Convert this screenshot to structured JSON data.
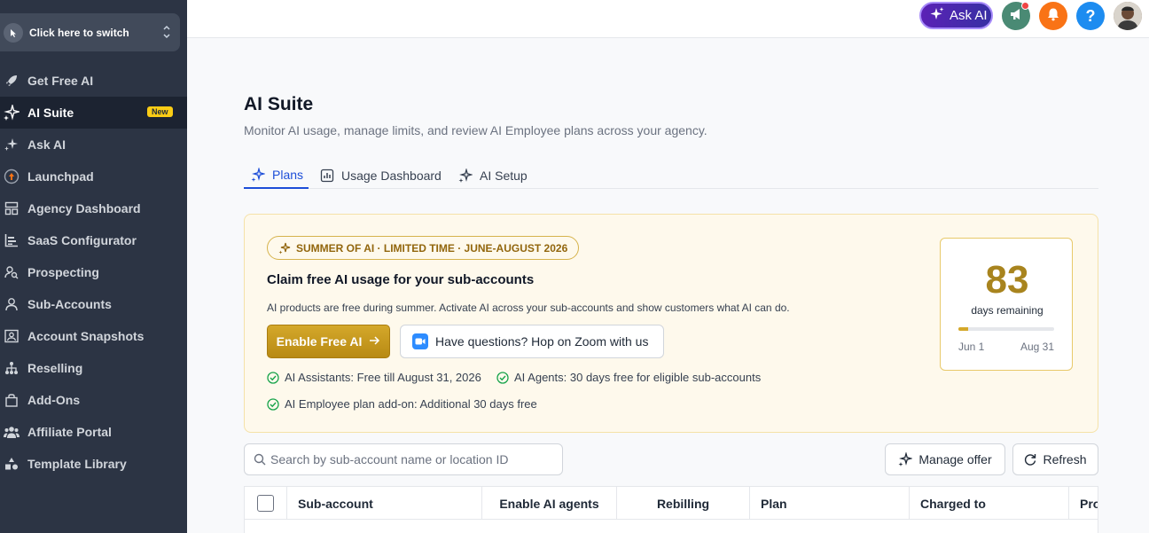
{
  "switcher": {
    "label": "Click here to switch"
  },
  "sidebar": {
    "items": [
      {
        "label": "Get Free AI",
        "icon": "rocket-icon"
      },
      {
        "label": "AI Suite",
        "icon": "sparkles-icon",
        "badge": "New"
      },
      {
        "label": "Ask AI",
        "icon": "sparkles-icon"
      },
      {
        "label": "Launchpad",
        "icon": "launchpad-icon"
      },
      {
        "label": "Agency Dashboard",
        "icon": "dashboard-icon"
      },
      {
        "label": "SaaS Configurator",
        "icon": "chart-icon"
      },
      {
        "label": "Prospecting",
        "icon": "user-search-icon"
      },
      {
        "label": "Sub-Accounts",
        "icon": "user-icon"
      },
      {
        "label": "Account Snapshots",
        "icon": "snapshot-icon"
      },
      {
        "label": "Reselling",
        "icon": "hierarchy-icon"
      },
      {
        "label": "Add-Ons",
        "icon": "bag-icon"
      },
      {
        "label": "Affiliate Portal",
        "icon": "users-icon"
      },
      {
        "label": "Template Library",
        "icon": "shapes-icon"
      }
    ]
  },
  "topbar": {
    "ask_ai_label": "Ask AI",
    "help_label": "?"
  },
  "page": {
    "title": "AI Suite",
    "subtitle": "Monitor AI usage, manage limits, and review AI Employee plans across your agency."
  },
  "tabs": [
    {
      "label": "Plans",
      "active": true
    },
    {
      "label": "Usage Dashboard",
      "active": false
    },
    {
      "label": "AI Setup",
      "active": false
    }
  ],
  "promo": {
    "tag": "SUMMER OF AI · LIMITED TIME · JUNE-AUGUST 2026",
    "title": "Claim free AI usage for your sub-accounts",
    "description": "AI products are free during summer. Activate AI across your sub-accounts and show customers what AI can do.",
    "enable_label": "Enable Free AI",
    "zoom_label": "Have questions? Hop on Zoom with us",
    "checks": [
      "AI Assistants: Free till August 31, 2026",
      "AI Agents: 30 days free for eligible sub-accounts",
      "AI Employee plan add-on: Additional 30 days free"
    ],
    "days_remaining": "83",
    "days_label": "days remaining",
    "range_start": "Jun 1",
    "range_end": "Aug 31",
    "progress_fraction": 0.1,
    "accent_color": "#d4a82a"
  },
  "search": {
    "placeholder": "Search by sub-account name or location ID",
    "value": ""
  },
  "actions": {
    "manage_offer": "Manage offer",
    "refresh": "Refresh"
  },
  "table": {
    "columns": [
      "Sub-account",
      "Enable AI agents",
      "Rebilling",
      "Plan",
      "Charged to",
      "Pro"
    ]
  }
}
